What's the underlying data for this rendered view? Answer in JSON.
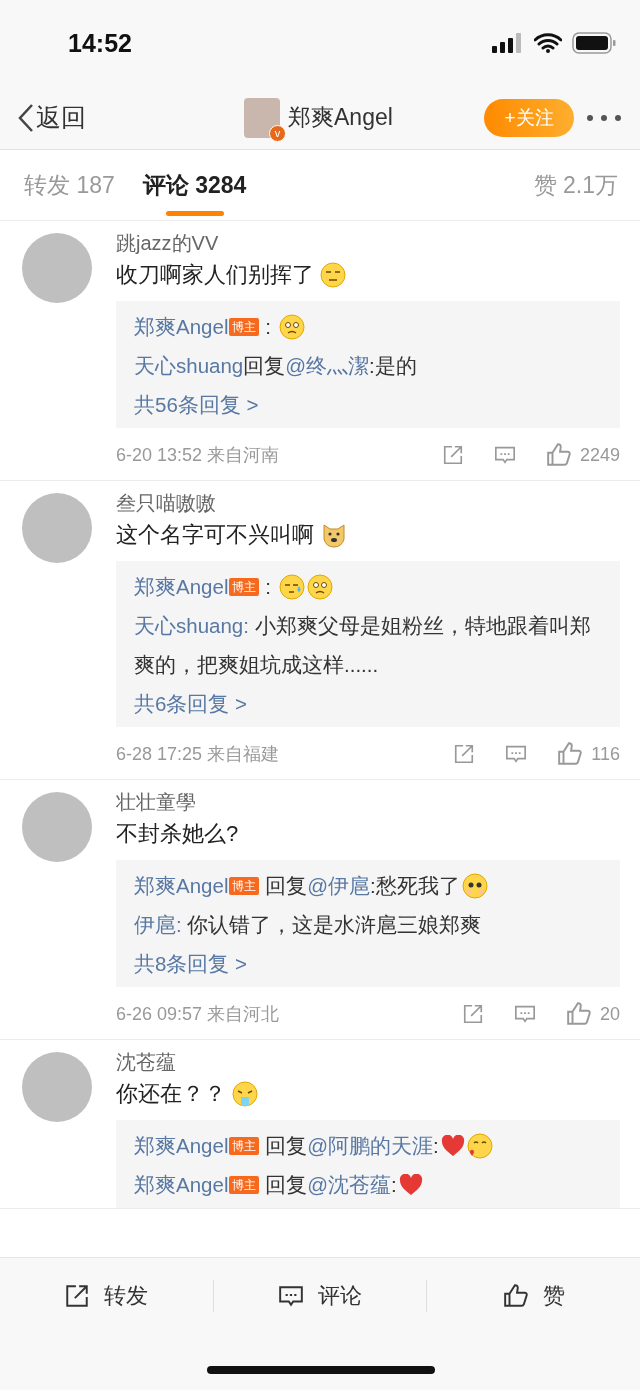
{
  "status_bar": {
    "time": "14:52"
  },
  "nav": {
    "back_label": "返回",
    "title": "郑爽Angel",
    "verified_mark": "v",
    "follow_button": "+关注"
  },
  "tabs": [
    {
      "label": "转发 187",
      "selected": false
    },
    {
      "label": "评论 3284",
      "selected": true
    }
  ],
  "likes_summary": "赞 2.1万",
  "comments": [
    {
      "username": "跳jazz的VV",
      "text": "收刀啊家人们别挥了",
      "emojis": [
        {
          "kind": "smirk"
        }
      ],
      "replies": [
        {
          "author": "郑爽Angel",
          "badge": "博主",
          "parts": [
            {
              "kind": "plain",
              "text": " : "
            }
          ],
          "emojis": [
            {
              "kind": "sad"
            }
          ]
        },
        {
          "author": "天心shuang",
          "parts": [
            {
              "kind": "plain",
              "text": "回复"
            },
            {
              "kind": "link",
              "text": "@终灬潔"
            },
            {
              "kind": "plain",
              "text": ":是的"
            }
          ]
        }
      ],
      "more_replies": "共56条回复 >",
      "meta": "6-20 13:52 来自河南",
      "likes": "2249"
    },
    {
      "username": "叁只喵嗷嗷",
      "text": "这个名字可不兴叫啊",
      "emojis": [
        {
          "kind": "doge"
        }
      ],
      "replies": [
        {
          "author": "郑爽Angel",
          "badge": "博主",
          "parts": [
            {
              "kind": "plain",
              "text": " : "
            }
          ],
          "emojis": [
            {
              "kind": "sweat"
            },
            {
              "kind": "sad"
            }
          ]
        },
        {
          "author": "天心shuang:",
          "parts": [
            {
              "kind": "plain",
              "text": " 小郑爽父母是姐粉丝，特地跟着叫郑爽的，把爽姐坑成这样......"
            }
          ]
        }
      ],
      "more_replies": "共6条回复 >",
      "meta": "6-28 17:25 来自福建",
      "likes": "116"
    },
    {
      "username": "壮壮童學",
      "text": "不封杀她么?",
      "replies": [
        {
          "author": "郑爽Angel",
          "badge": "博主",
          "parts": [
            {
              "kind": "plain",
              "text": " 回复"
            },
            {
              "kind": "link",
              "text": "@伊扈"
            },
            {
              "kind": "plain",
              "text": ":愁死我了"
            }
          ],
          "emojis": [
            {
              "kind": "shy"
            }
          ]
        },
        {
          "author": "伊扈:",
          "parts": [
            {
              "kind": "plain",
              "text": " 你认错了，这是水浒扈三娘郑爽"
            }
          ]
        }
      ],
      "more_replies": "共8条回复 >",
      "meta": "6-26 09:57 来自河北",
      "likes": "20"
    },
    {
      "username": "沈苍蕴",
      "text": "你还在？？",
      "emojis": [
        {
          "kind": "vomit"
        }
      ],
      "replies": [
        {
          "author": "郑爽Angel",
          "badge": "博主",
          "parts": [
            {
              "kind": "plain",
              "text": " 回复"
            },
            {
              "kind": "link",
              "text": "@阿鹏的天涯"
            },
            {
              "kind": "plain",
              "text": ":"
            }
          ],
          "emojis": [
            {
              "kind": "heart"
            },
            {
              "kind": "kiss"
            }
          ]
        },
        {
          "author": "郑爽Angel",
          "badge": "博主",
          "parts": [
            {
              "kind": "plain",
              "text": " 回复"
            },
            {
              "kind": "link",
              "text": "@沈苍蕴"
            },
            {
              "kind": "plain",
              "text": ":"
            }
          ],
          "emojis": [
            {
              "kind": "heart"
            }
          ]
        }
      ]
    }
  ],
  "bottom_bar": [
    {
      "kind": "share",
      "label": "转发"
    },
    {
      "kind": "comment",
      "label": "评论"
    },
    {
      "kind": "like",
      "label": "赞"
    }
  ]
}
